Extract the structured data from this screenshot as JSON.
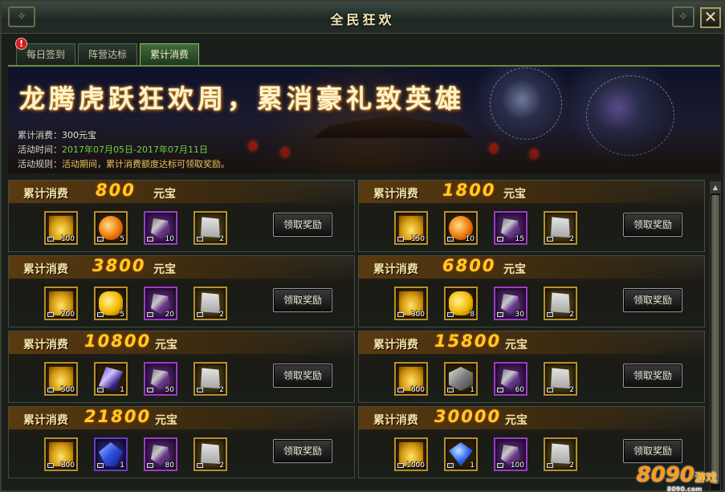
{
  "window": {
    "title": "全民狂欢",
    "close_label": "✕"
  },
  "tabs": [
    {
      "label": "每日签到",
      "alert": "!"
    },
    {
      "label": "阵营达标"
    },
    {
      "label": "累计消费",
      "active": true
    }
  ],
  "banner": {
    "headline": "龙腾虎跃狂欢周，累消豪礼致英雄",
    "spent_label": "累计消费：",
    "spent_value": "300元宝",
    "time_label": "活动时间：",
    "time_value": "2017年07月05日-2017年07月11日",
    "rule_label": "活动规则：",
    "rule_value": "活动期间，累计消费额度达标可领取奖励。"
  },
  "tiers": [
    {
      "label": "累计消费",
      "amount": "800",
      "unit": "元宝",
      "button": "领取奖励",
      "items": [
        {
          "icon": "gold-ingot-icon",
          "count": "100"
        },
        {
          "icon": "fire-orb-icon",
          "count": "5"
        },
        {
          "icon": "purple-armor-icon",
          "count": "10"
        },
        {
          "icon": "scroll-icon",
          "count": "2"
        }
      ]
    },
    {
      "label": "累计消费",
      "amount": "1800",
      "unit": "元宝",
      "button": "领取奖励",
      "items": [
        {
          "icon": "gold-ingot-icon",
          "count": "150"
        },
        {
          "icon": "fire-orb-icon",
          "count": "10"
        },
        {
          "icon": "purple-armor-icon",
          "count": "15"
        },
        {
          "icon": "scroll-icon",
          "count": "2"
        }
      ]
    },
    {
      "label": "累计消费",
      "amount": "3800",
      "unit": "元宝",
      "button": "领取奖励",
      "items": [
        {
          "icon": "gold-ingot-icon",
          "count": "200"
        },
        {
          "icon": "golden-apple-icon",
          "count": "5"
        },
        {
          "icon": "purple-armor-icon",
          "count": "20"
        },
        {
          "icon": "scroll-icon",
          "count": "2"
        }
      ]
    },
    {
      "label": "累计消费",
      "amount": "6800",
      "unit": "元宝",
      "button": "领取奖励",
      "items": [
        {
          "icon": "gold-ingot-icon",
          "count": "300"
        },
        {
          "icon": "golden-apple-icon",
          "count": "8"
        },
        {
          "icon": "purple-armor-icon",
          "count": "30"
        },
        {
          "icon": "scroll-icon",
          "count": "2"
        }
      ]
    },
    {
      "label": "累计消费",
      "amount": "10800",
      "unit": "元宝",
      "button": "领取奖励",
      "items": [
        {
          "icon": "gold-ingot-icon",
          "count": "500"
        },
        {
          "icon": "crystal-blade-icon",
          "count": "1"
        },
        {
          "icon": "purple-armor-icon",
          "count": "50"
        },
        {
          "icon": "scroll-icon",
          "count": "2"
        }
      ]
    },
    {
      "label": "累计消费",
      "amount": "15800",
      "unit": "元宝",
      "button": "领取奖励",
      "items": [
        {
          "icon": "gold-ingot-icon",
          "count": "600"
        },
        {
          "icon": "silver-cube-icon",
          "count": "1"
        },
        {
          "icon": "purple-armor-icon",
          "count": "60"
        },
        {
          "icon": "scroll-icon",
          "count": "2"
        }
      ]
    },
    {
      "label": "累计消费",
      "amount": "21800",
      "unit": "元宝",
      "button": "领取奖励",
      "items": [
        {
          "icon": "gold-ingot-icon",
          "count": "800"
        },
        {
          "icon": "blue-gem-icon",
          "count": "1"
        },
        {
          "icon": "purple-armor-icon",
          "count": "80"
        },
        {
          "icon": "scroll-icon",
          "count": "2"
        }
      ]
    },
    {
      "label": "累计消费",
      "amount": "30000",
      "unit": "元宝",
      "button": "领取奖励",
      "items": [
        {
          "icon": "gold-ingot-icon",
          "count": "1000"
        },
        {
          "icon": "blue-diamond-icon",
          "count": "1"
        },
        {
          "icon": "purple-armor-icon",
          "count": "100"
        },
        {
          "icon": "scroll-icon",
          "count": "2"
        }
      ]
    }
  ],
  "watermark": {
    "brand": "8090",
    "suffix": "游戏",
    "url": "8090.com"
  }
}
